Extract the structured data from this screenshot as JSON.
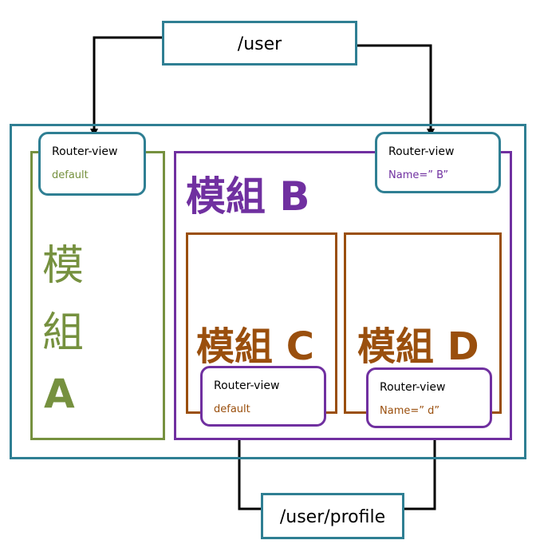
{
  "routes": {
    "top": "/user",
    "bottom": "/user/profile"
  },
  "modules": {
    "a": {
      "chars": [
        "模",
        "組",
        "A"
      ]
    },
    "b": {
      "label": "模組 B"
    },
    "c": {
      "label": "模組 C"
    },
    "d": {
      "label": "模組 D"
    }
  },
  "router_views": {
    "a": {
      "title": "Router-view",
      "name": "default"
    },
    "b": {
      "title": "Router-view",
      "name": "Name=” B”"
    },
    "c": {
      "title": "Router-view",
      "name": "default"
    },
    "d": {
      "title": "Router-view",
      "name": "Name=” d”"
    }
  },
  "colors": {
    "teal": "#2f7f93",
    "green": "#76913f",
    "purple": "#7030a0",
    "brown": "#9a4f0d"
  }
}
